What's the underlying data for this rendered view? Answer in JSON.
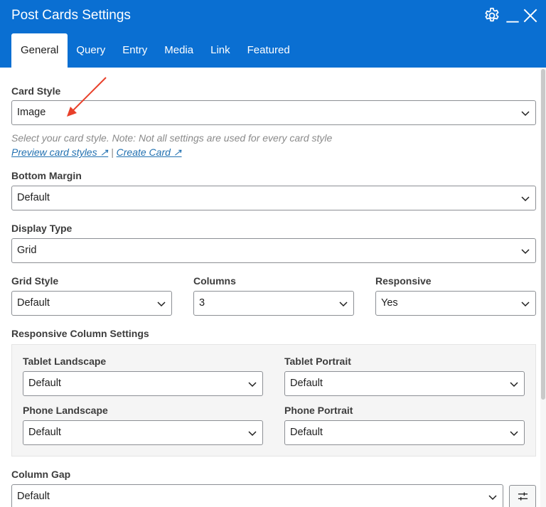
{
  "window": {
    "title": "Post Cards Settings"
  },
  "icons": {
    "settings": "gear-icon",
    "minimize": "minimize-icon",
    "close": "close-icon",
    "spacing": "sliders-icon"
  },
  "tabs": [
    {
      "label": "General",
      "active": true
    },
    {
      "label": "Query",
      "active": false
    },
    {
      "label": "Entry",
      "active": false
    },
    {
      "label": "Media",
      "active": false
    },
    {
      "label": "Link",
      "active": false
    },
    {
      "label": "Featured",
      "active": false
    }
  ],
  "card_style": {
    "label": "Card Style",
    "value": "Image",
    "help": "Select your card style. Note: Not all settings are used for every card style",
    "link_preview": "Preview card styles ↗",
    "separator": "|",
    "link_create": "Create Card ↗"
  },
  "bottom_margin": {
    "label": "Bottom Margin",
    "value": "Default"
  },
  "display_type": {
    "label": "Display Type",
    "value": "Grid"
  },
  "grid_style": {
    "label": "Grid Style",
    "value": "Default"
  },
  "columns": {
    "label": "Columns",
    "value": "3"
  },
  "responsive": {
    "label": "Responsive",
    "value": "Yes"
  },
  "responsive_columns": {
    "label": "Responsive Column Settings",
    "tablet_landscape": {
      "label": "Tablet Landscape",
      "value": "Default"
    },
    "tablet_portrait": {
      "label": "Tablet Portrait",
      "value": "Default"
    },
    "phone_landscape": {
      "label": "Phone Landscape",
      "value": "Default"
    },
    "phone_portrait": {
      "label": "Phone Portrait",
      "value": "Default"
    }
  },
  "column_gap": {
    "label": "Column Gap",
    "value": "Default"
  },
  "colors": {
    "header": "#0a6fd2",
    "link": "#2271b1",
    "annotation_arrow": "#e8402a"
  }
}
